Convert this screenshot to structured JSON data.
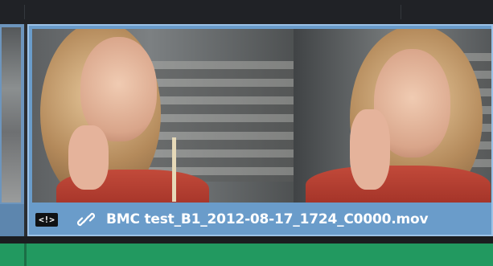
{
  "timeline": {
    "clip": {
      "name": "BMC test_B1_2012-08-17_1724_C0000.mov",
      "badge_label": "<!>",
      "link_icon": "link-icon",
      "thumbnail_frames": 2,
      "selected": true
    },
    "colors": {
      "video_clip": "#6a9cca",
      "video_clip_border": "#9cc2e7",
      "audio_clip": "#229960",
      "background": "#1f2124"
    }
  }
}
